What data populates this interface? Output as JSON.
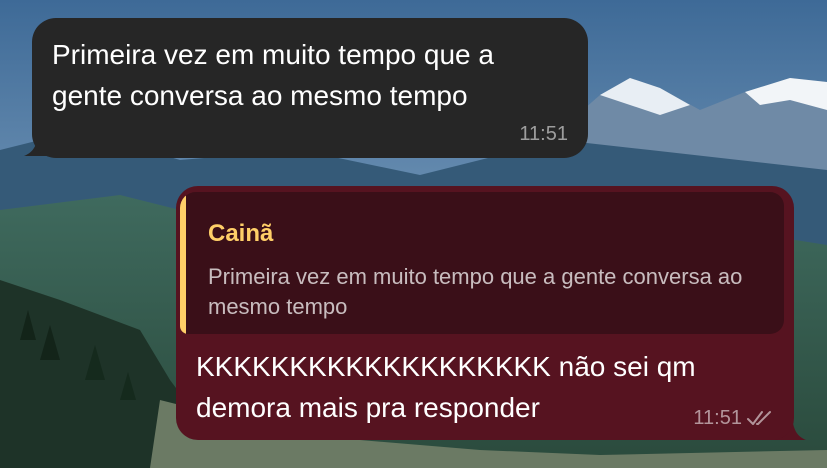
{
  "messages": {
    "incoming": {
      "text": "Primeira vez em muito tempo que a gente conversa ao mesmo tempo",
      "time": "11:51"
    },
    "outgoing": {
      "reply": {
        "author": "Cainã",
        "quote": "Primeira vez em muito tempo que a gente conversa ao mesmo tempo"
      },
      "text": "KKKKKKKKKKKKKKKKKKK não sei qm demora mais pra responder",
      "time": "11:51",
      "status_icon": "double-check-icon"
    }
  },
  "colors": {
    "incoming_bubble": "#262626",
    "outgoing_bubble": "#561320",
    "reply_background": "#3a0f18",
    "reply_accent": "#ffcf68"
  }
}
